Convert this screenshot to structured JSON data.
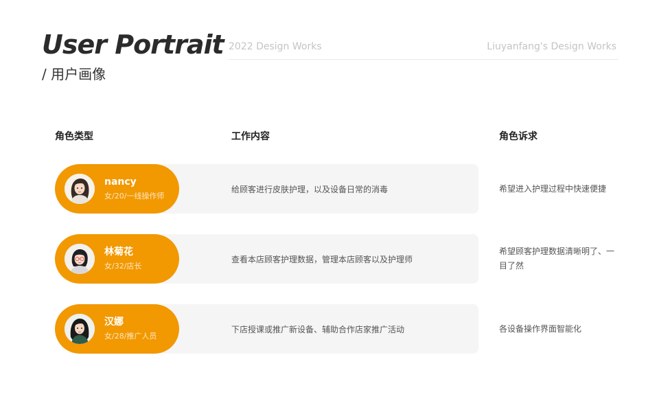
{
  "header": {
    "title": "User Portrait",
    "subtitle": "/ 用户画像",
    "year_works": "2022 Design Works",
    "author_works": "Liuyanfang's Design Works"
  },
  "columns": {
    "role": "角色类型",
    "work": "工作内容",
    "need": "角色诉求"
  },
  "users": [
    {
      "name": "nancy",
      "meta": "女/20/一线操作师",
      "work": "给顾客进行皮肤护理，以及设备日常的消毒",
      "need": "希望进入护理过程中快速便捷"
    },
    {
      "name": "林菊花",
      "meta": "女/32/店长",
      "work": "查看本店顾客护理数据，管理本店顾客以及护理师",
      "need": "希望顾客护理数据清晰明了、一目了然"
    },
    {
      "name": "汉娜",
      "meta": "女/28/推广人员",
      "work": "下店授课或推广新设备、辅助合作店家推广活动",
      "need": "各设备操作界面智能化"
    }
  ],
  "colors": {
    "accent": "#f29800",
    "row_bg": "#f5f5f5",
    "divider": "#e8e8e8"
  },
  "icons": [
    "avatar-illustration"
  ]
}
